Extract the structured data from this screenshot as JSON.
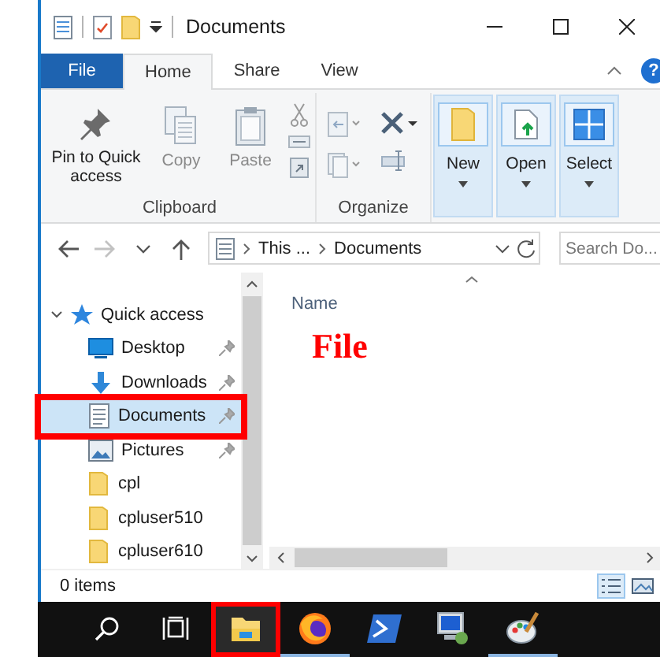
{
  "window": {
    "title": "Documents"
  },
  "ribbon": {
    "tabs": [
      {
        "label": "File",
        "kind": "file",
        "selected": false
      },
      {
        "label": "Home",
        "kind": "tab",
        "selected": true
      },
      {
        "label": "Share",
        "kind": "tab",
        "selected": false
      },
      {
        "label": "View",
        "kind": "tab",
        "selected": false
      }
    ],
    "help": "?",
    "groups": [
      {
        "kind": "clipboard",
        "label": "Clipboard",
        "buttons": [
          {
            "label": "Pin to Quick access",
            "kind": "pin",
            "disabled": false
          },
          {
            "label": "Copy",
            "kind": "copy",
            "disabled": true
          },
          {
            "label": "Paste",
            "kind": "paste",
            "disabled": true
          }
        ]
      },
      {
        "kind": "organize",
        "label": "Organize"
      }
    ],
    "split_buttons": [
      {
        "label": "New",
        "kind": "new"
      },
      {
        "label": "Open",
        "kind": "open"
      },
      {
        "label": "Select",
        "kind": "select"
      }
    ]
  },
  "address": {
    "nav_buttons": [
      {
        "kind": "back",
        "disabled": false
      },
      {
        "kind": "forward",
        "disabled": true
      },
      {
        "kind": "recent",
        "disabled": false
      },
      {
        "kind": "up",
        "disabled": false
      }
    ],
    "path": [
      {
        "label": "This ..."
      },
      {
        "label": "Documents"
      }
    ]
  },
  "search": {
    "placeholder": "Search Do..."
  },
  "nav": {
    "items": [
      {
        "label": "Quick access",
        "expanded": true,
        "children": [
          {
            "label": "Desktop",
            "kind": "desktop",
            "pinned": true,
            "selected": false,
            "annotated": false
          },
          {
            "label": "Downloads",
            "kind": "downloads",
            "pinned": true,
            "selected": false,
            "annotated": false
          },
          {
            "label": "Documents",
            "kind": "documents",
            "pinned": true,
            "selected": true,
            "annotated": true
          },
          {
            "label": "Pictures",
            "kind": "pictures",
            "pinned": true,
            "selected": false,
            "annotated": false
          },
          {
            "label": "cpl",
            "kind": "folder",
            "pinned": false,
            "selected": false,
            "annotated": false
          },
          {
            "label": "cpluser510",
            "kind": "folder",
            "pinned": false,
            "selected": false,
            "annotated": false
          },
          {
            "label": "cpluser610",
            "kind": "folder",
            "pinned": false,
            "selected": false,
            "annotated": false
          }
        ]
      }
    ]
  },
  "content": {
    "columns": [
      {
        "label": "Name",
        "sorted": true
      }
    ],
    "annotation": "File"
  },
  "status_bar": {
    "text": "0 items",
    "views": [
      {
        "kind": "details",
        "selected": true
      },
      {
        "kind": "large_icons",
        "selected": false
      }
    ]
  },
  "taskbar": {
    "items": [
      {
        "kind": "search",
        "running": false,
        "annotated": false
      },
      {
        "kind": "task_view",
        "running": false,
        "annotated": false
      },
      {
        "kind": "explorer",
        "running": false,
        "annotated": true
      },
      {
        "kind": "firefox",
        "running": true,
        "annotated": false
      },
      {
        "kind": "powershell",
        "running": false,
        "annotated": false
      },
      {
        "kind": "remote",
        "running": false,
        "annotated": false
      },
      {
        "kind": "paint",
        "running": true,
        "annotated": false
      }
    ]
  }
}
